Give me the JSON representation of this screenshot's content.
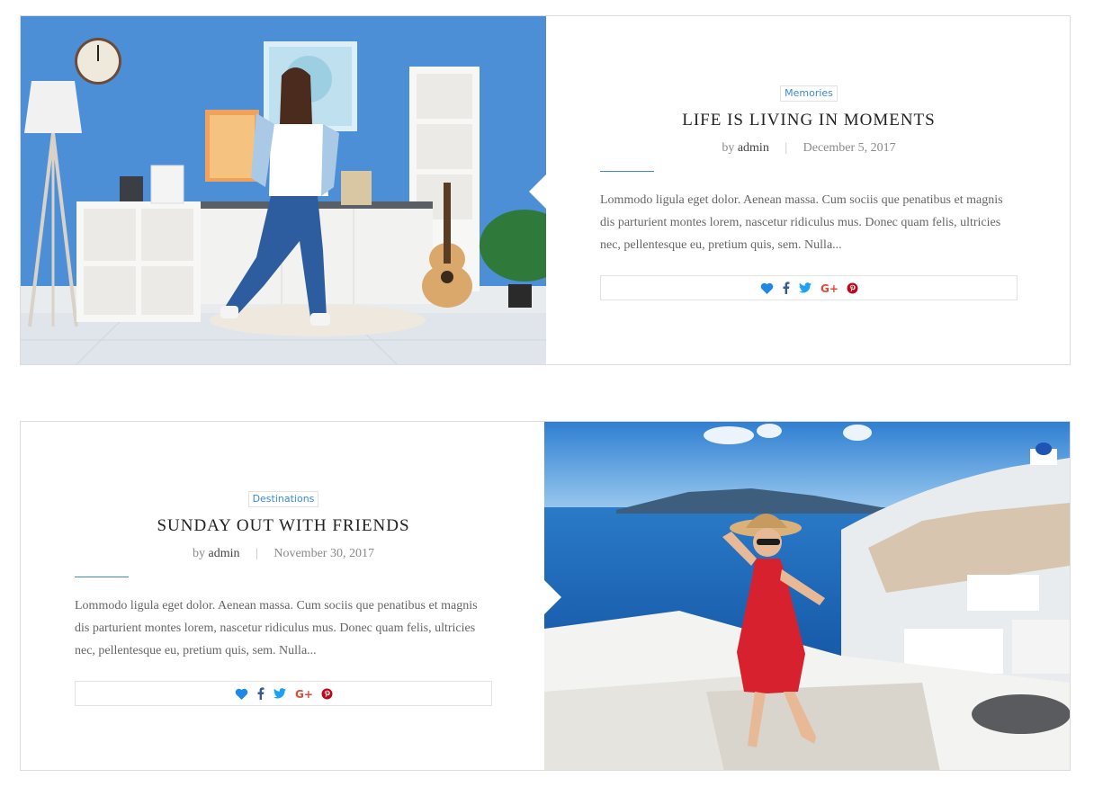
{
  "posts": [
    {
      "category": "Memories",
      "title": "LIFE IS LIVING IN MOMENTS",
      "by": "by",
      "author": "admin",
      "date": "December 5, 2017",
      "excerpt": "Lommodo ligula eget dolor. Aenean massa. Cum sociis que penatibus et magnis dis parturient montes lorem, nascetur ridiculus mus. Donec quam felis, ultricies nec, pellentesque eu, pretium quis, sem. Nulla...",
      "share_icons": [
        "heart-icon",
        "facebook-icon",
        "twitter-icon",
        "google-plus-icon",
        "pinterest-icon"
      ]
    },
    {
      "category": "Destinations",
      "title": "SUNDAY OUT WITH FRIENDS",
      "by": "by",
      "author": "admin",
      "date": "November 30, 2017",
      "excerpt": "Lommodo ligula eget dolor. Aenean massa. Cum sociis que penatibus et magnis dis parturient montes lorem, nascetur ridiculus mus. Donec quam felis, ultricies nec, pellentesque eu, pretium quis, sem. Nulla...",
      "share_icons": [
        "heart-icon",
        "facebook-icon",
        "twitter-icon",
        "google-plus-icon",
        "pinterest-icon"
      ]
    }
  ],
  "colors": {
    "accent": "#3a8bd6",
    "facebook": "#3b5998",
    "twitter": "#1da1f2",
    "google_plus": "#dd4b39",
    "pinterest": "#bd081c"
  }
}
